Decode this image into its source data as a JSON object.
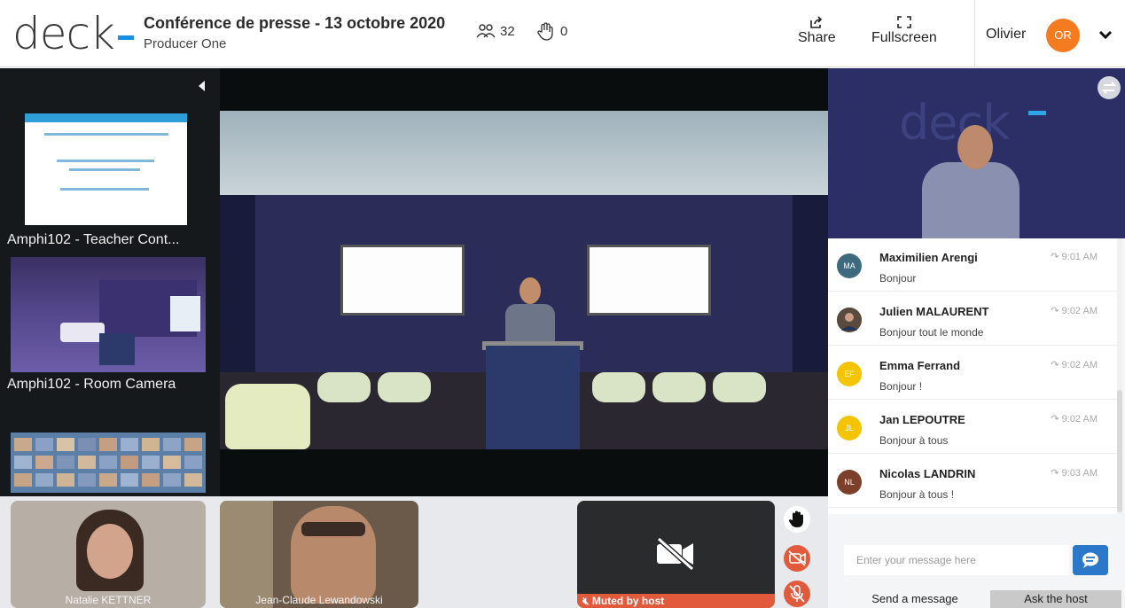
{
  "header": {
    "logo": "deck",
    "title": "Conférence de presse - 13 octobre 2020",
    "subtitle": "Producer One",
    "participants_count": "32",
    "hands_count": "0",
    "share_label": "Share",
    "fullscreen_label": "Fullscreen",
    "user_name": "Olivier",
    "user_initials": "OR",
    "user_avatar_color": "#f47b20"
  },
  "sources": [
    {
      "label": "Amphi102 - Teacher Cont..."
    },
    {
      "label": "Amphi102 - Room Camera"
    }
  ],
  "participants": [
    {
      "name": "Natalie KETTNER"
    },
    {
      "name": "Jean-Claude Lewandowski"
    },
    {
      "status": "Muted by host"
    }
  ],
  "chat": {
    "messages": [
      {
        "initials": "MA",
        "color": "#3d6b7d",
        "author": "Maximilien Arengi",
        "time": "9:01 AM",
        "text": "Bonjour"
      },
      {
        "initials": "",
        "color": "#6b4a37",
        "author": "Julien MALAURENT",
        "time": "9:02 AM",
        "text": "Bonjour tout le monde"
      },
      {
        "initials": "EF",
        "color": "#f5c400",
        "author": "Emma Ferrand",
        "time": "9:02 AM",
        "text": "Bonjour !"
      },
      {
        "initials": "JL",
        "color": "#f5c400",
        "author": "Jan LEPOUTRE",
        "time": "9:02 AM",
        "text": "Bonjour à tous"
      },
      {
        "initials": "NL",
        "color": "#7b3f2a",
        "author": "Nicolas LANDRIN",
        "time": "9:03 AM",
        "text": "Bonjour à tous !"
      }
    ],
    "input_placeholder": "Enter your message here",
    "tab_send": "Send a message",
    "tab_ask": "Ask the host"
  },
  "colors": {
    "accent": "#1a8fe3",
    "muted_bar": "#e25a3c",
    "send_button": "#2b77c9"
  }
}
